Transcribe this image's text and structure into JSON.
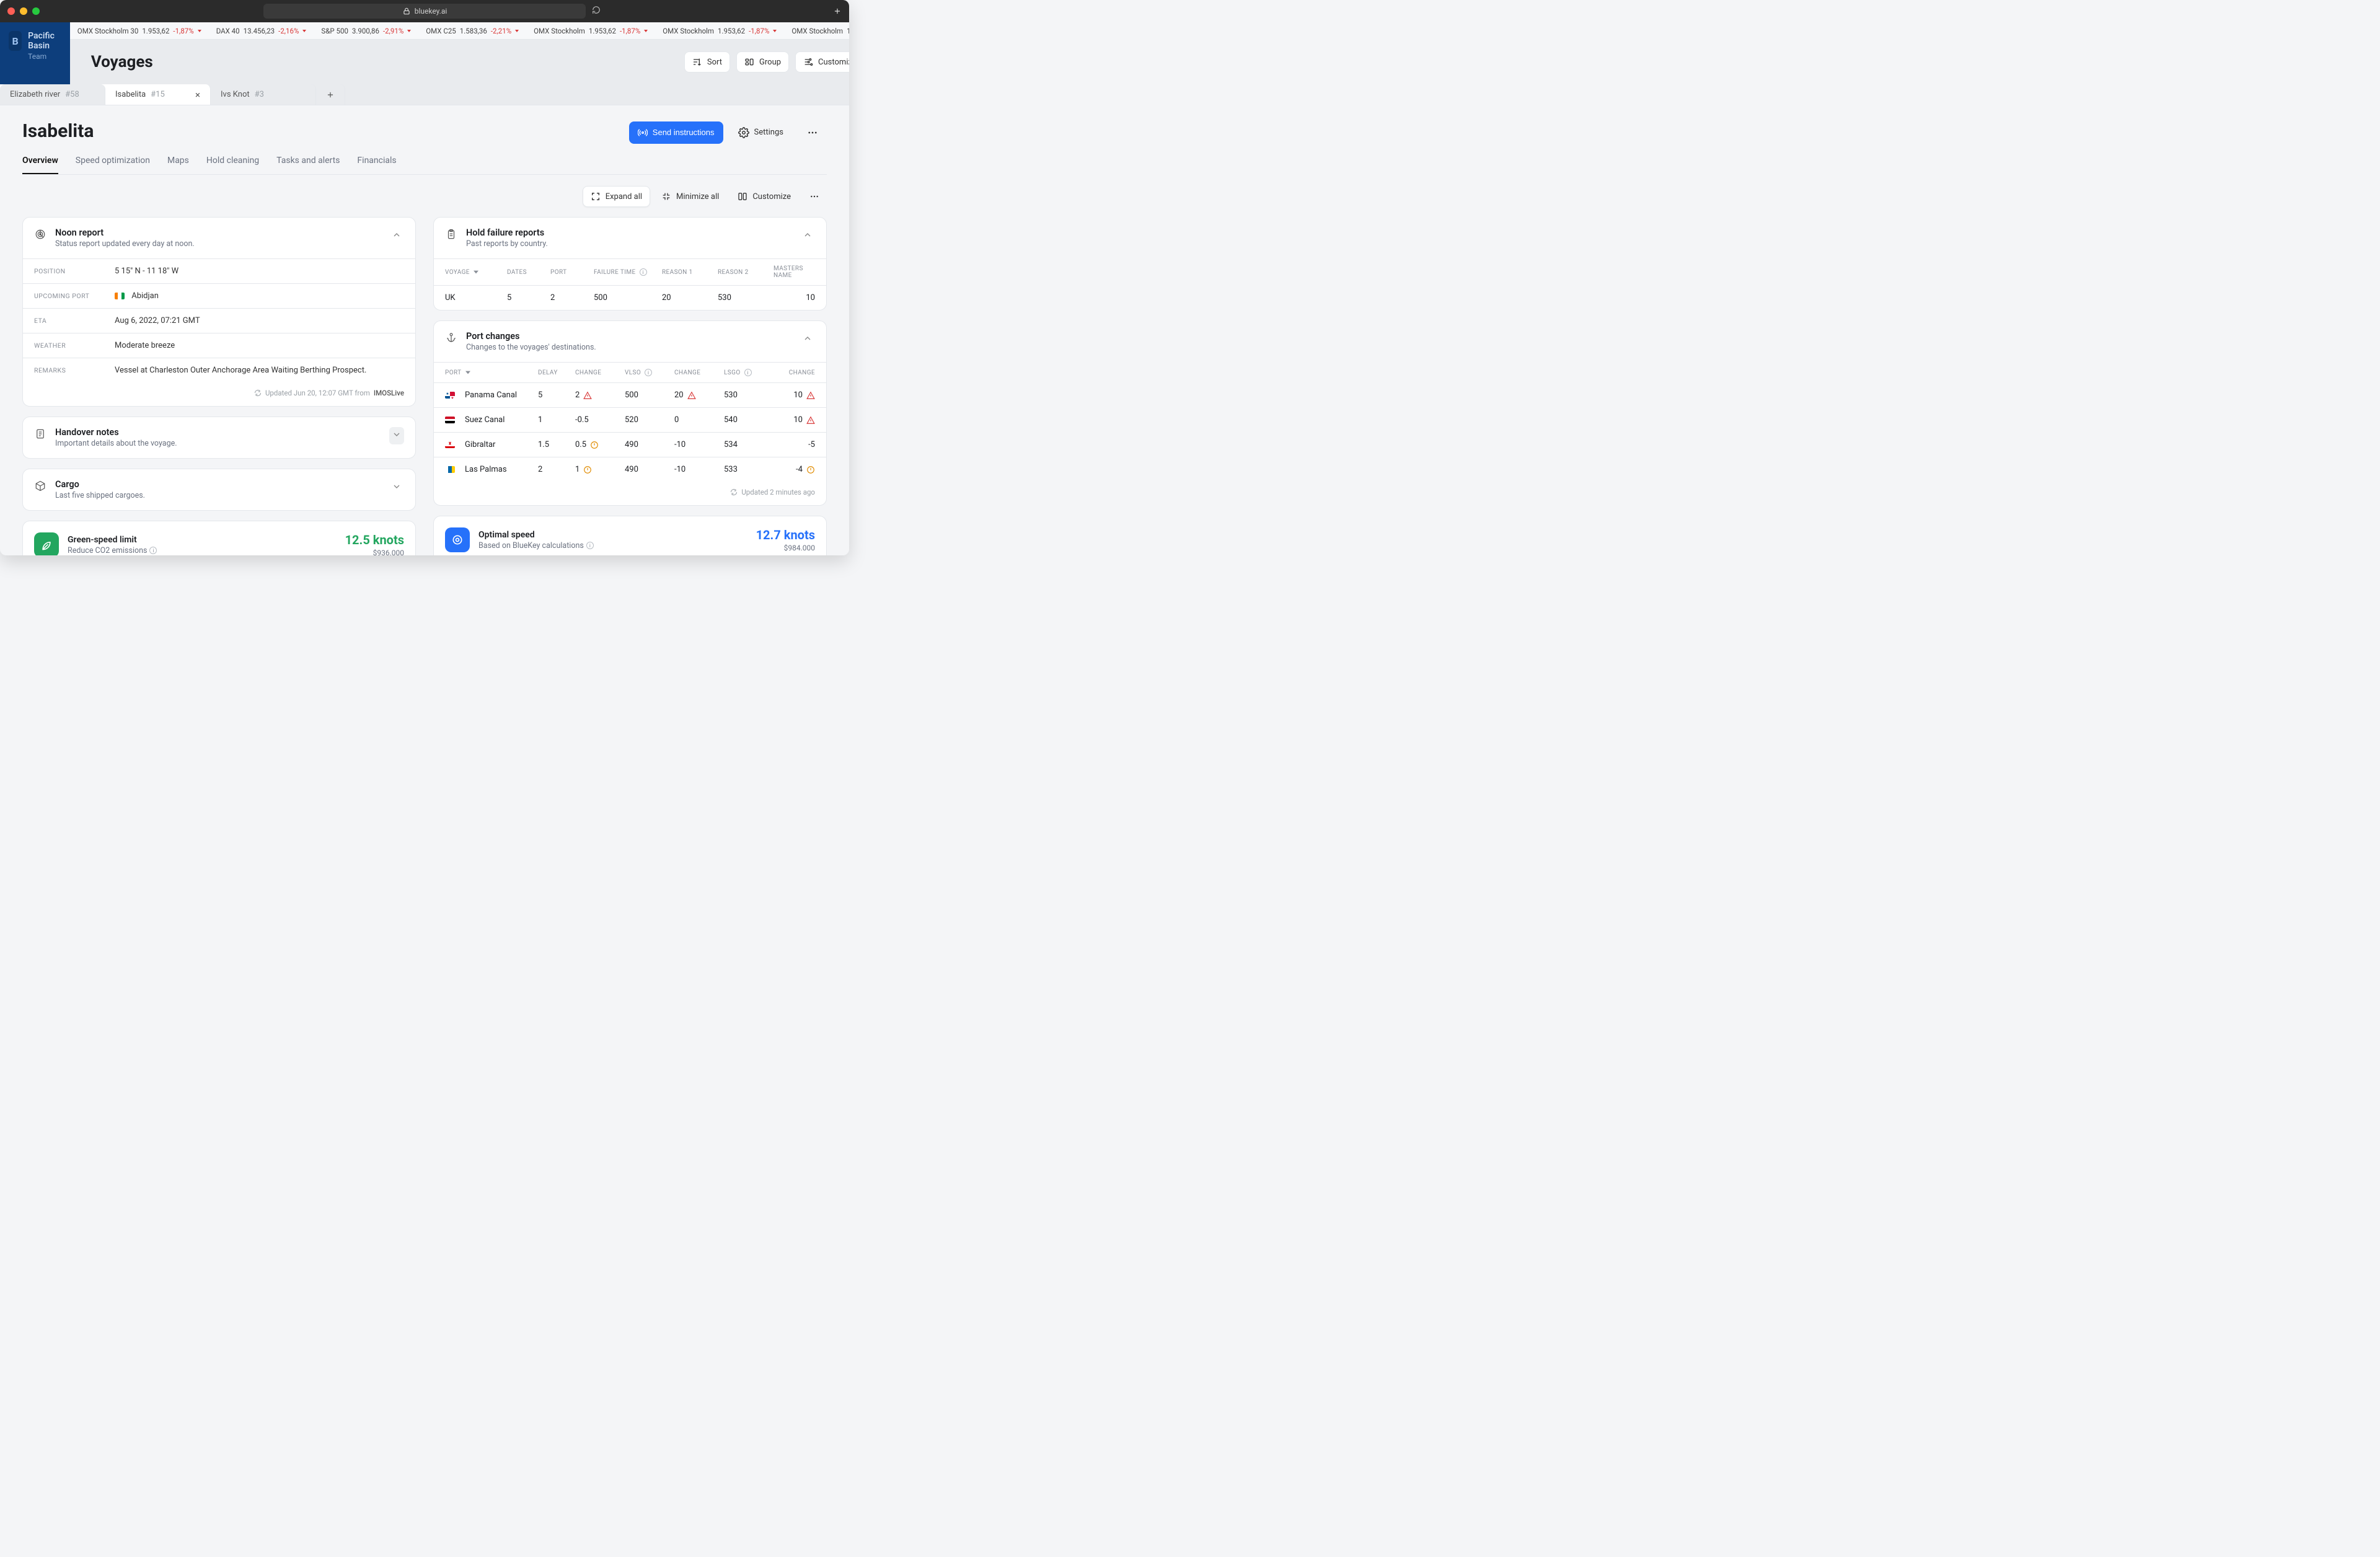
{
  "browser": {
    "url": "bluekey.ai"
  },
  "brand": {
    "letter": "B",
    "name": "Pacific Basin",
    "sub": "Team"
  },
  "ticker": [
    {
      "name": "OMX Stockholm 30",
      "value": "1.953,62",
      "change": "-1,87%"
    },
    {
      "name": "DAX 40",
      "value": "13.456,23",
      "change": "-2,16%"
    },
    {
      "name": "S&P 500",
      "value": "3.900,86",
      "change": "-2,91%"
    },
    {
      "name": "OMX C25",
      "value": "1.583,36",
      "change": "-2,21%"
    },
    {
      "name": "OMX Stockholm",
      "value": "1.953,62",
      "change": "-1,87%"
    },
    {
      "name": "OMX Stockholm",
      "value": "1.953,62",
      "change": "-1,87%"
    },
    {
      "name": "OMX Stockholm",
      "value": "1.953,62",
      "change": "-1,87%"
    },
    {
      "name": "OMX St",
      "value": "",
      "change": ""
    }
  ],
  "header": {
    "title": "Voyages",
    "buttons": {
      "sort": "Sort",
      "group": "Group",
      "customize": "Customize",
      "settings": "Settings"
    }
  },
  "docTabs": {
    "items": [
      {
        "name": "Elizabeth river",
        "num": "#58",
        "active": false
      },
      {
        "name": "Isabelita",
        "num": "#15",
        "active": true
      },
      {
        "name": "Ivs Knot",
        "num": "#3",
        "active": false
      }
    ]
  },
  "page": {
    "title": "Isabelita",
    "actions": {
      "send": "Send instructions",
      "settings": "Settings"
    },
    "tabs": [
      "Overview",
      "Speed optimization",
      "Maps",
      "Hold cleaning",
      "Tasks and alerts",
      "Financials"
    ],
    "toolbar": {
      "expand": "Expand all",
      "minimize": "Minimize all",
      "customize": "Customize"
    }
  },
  "noon": {
    "title": "Noon report",
    "subtitle": "Status report updated every day at noon.",
    "rows": {
      "position": {
        "label": "POSITION",
        "value": "5 15\" N - 11 18\" W"
      },
      "upcoming": {
        "label": "UPCOMING PORT",
        "value": "Abidjan"
      },
      "eta": {
        "label": "ETA",
        "value": "Aug 6, 2022, 07:21 GMT"
      },
      "weather": {
        "label": "WEATHER",
        "value": "Moderate breeze"
      },
      "remarks": {
        "label": "REMARKS",
        "value": "Vessel at Charleston Outer Anchorage Area Waiting Berthing Prospect."
      }
    },
    "footer": {
      "text": "Updated Jun 20, 12:07 GMT from",
      "source": "IMOSLive"
    }
  },
  "handover": {
    "title": "Handover notes",
    "subtitle": "Important details about the voyage."
  },
  "cargo": {
    "title": "Cargo",
    "subtitle": "Last five shipped cargoes."
  },
  "greenSpeed": {
    "title": "Green-speed limit",
    "subtitle": "Reduce CO2 emissions",
    "value": "12.5 knots",
    "sub": "$936.000"
  },
  "holdFailure": {
    "title": "Hold failure reports",
    "subtitle": "Past reports by country.",
    "columns": {
      "voyage": "VOYAGE",
      "dates": "DATES",
      "port": "PORT",
      "ft": "FAILURE TIME",
      "r1": "REASON 1",
      "r2": "REASON 2",
      "mn": "MASTERS NAME"
    },
    "rows": [
      {
        "voyage": "UK",
        "dates": "5",
        "port": "2",
        "ft": "500",
        "r1": "20",
        "r2": "530",
        "mn": "10"
      }
    ]
  },
  "portChanges": {
    "title": "Port changes",
    "subtitle": "Changes to the voyages' destinations.",
    "columns": {
      "port": "PORT",
      "delay": "DELAY",
      "change": "CHANGE",
      "vlso": "VLSO",
      "change2": "CHANGE",
      "lsgo": "LSGO",
      "change3": "CHANGE"
    },
    "rows": [
      {
        "port": "Panama Canal",
        "flag": "panama",
        "delay": "5",
        "change": "2",
        "cw": "red",
        "vlso": "500",
        "change2": "20",
        "c2w": "red",
        "lsgo": "530",
        "change3": "10",
        "c3w": "red"
      },
      {
        "port": "Suez Canal",
        "flag": "egypt",
        "delay": "1",
        "change": "-0.5",
        "cw": "",
        "vlso": "520",
        "change2": "0",
        "c2w": "",
        "lsgo": "540",
        "change3": "10",
        "c3w": "red"
      },
      {
        "port": "Gibraltar",
        "flag": "gibraltar",
        "delay": "1.5",
        "change": "0.5",
        "cw": "amb",
        "vlso": "490",
        "change2": "-10",
        "c2w": "",
        "lsgo": "534",
        "change3": "-5",
        "c3w": ""
      },
      {
        "port": "Las Palmas",
        "flag": "canary",
        "delay": "2",
        "change": "1",
        "cw": "amb",
        "vlso": "490",
        "change2": "-10",
        "c2w": "",
        "lsgo": "533",
        "change3": "-4",
        "c3w": "amb"
      }
    ],
    "footer": "Updated 2 minutes ago"
  },
  "optimal": {
    "title": "Optimal speed",
    "subtitle": "Based on BlueKey calculations",
    "value": "12.7 knots",
    "sub": "$984.000"
  }
}
